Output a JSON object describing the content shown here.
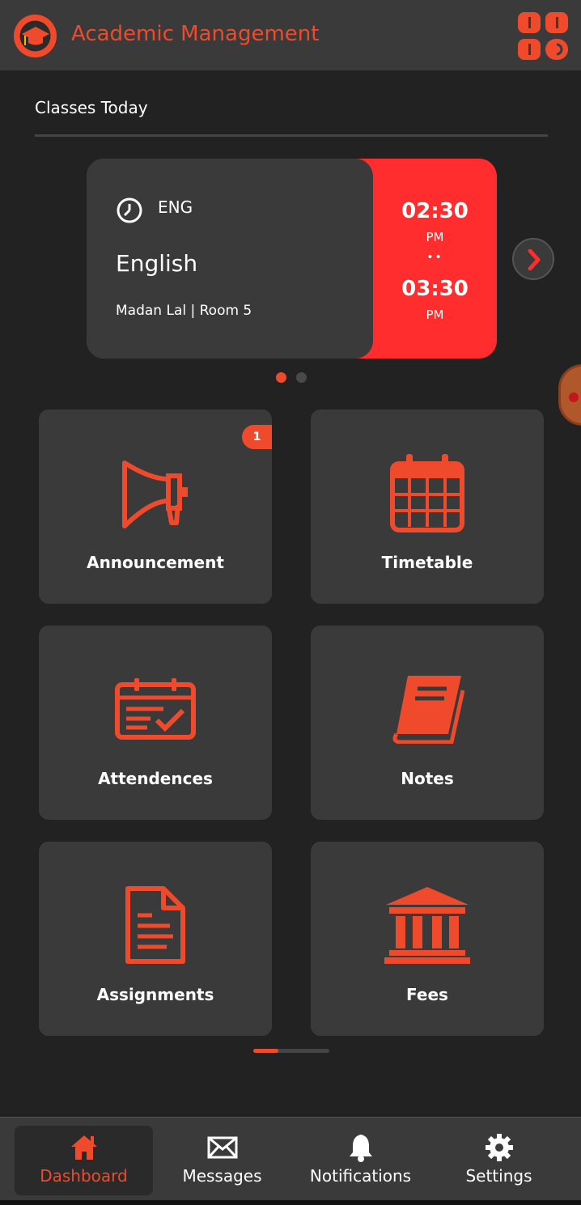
{
  "app": {
    "title": "Academic Management",
    "logo_icon": "graduation-cap-icon",
    "menu_icon": "grid-menu-icon"
  },
  "colors": {
    "accent": "#f04a2c",
    "card_time_bg": "#ff2d2d",
    "surface": "#3a3a3a",
    "background": "#222222"
  },
  "classes": {
    "section_title": "Classes Today",
    "current": {
      "code": "ENG",
      "name": "English",
      "meta": "Madan Lal | Room 5",
      "start_time": "02:30",
      "start_ampm": "PM",
      "separator": "••",
      "end_time": "03:30",
      "end_ampm": "PM"
    },
    "carousel_pages": 2,
    "carousel_active": 1
  },
  "tiles": [
    {
      "label": "Announcement",
      "icon": "megaphone-icon",
      "badge": "1"
    },
    {
      "label": "Timetable",
      "icon": "calendar-icon"
    },
    {
      "label": "Attendences",
      "icon": "attendance-calendar-icon"
    },
    {
      "label": "Notes",
      "icon": "book-icon"
    },
    {
      "label": "Assignments",
      "icon": "document-icon"
    },
    {
      "label": "Fees",
      "icon": "bank-icon"
    }
  ],
  "nav": [
    {
      "label": "Dashboard",
      "icon": "home-icon",
      "active": true
    },
    {
      "label": "Messages",
      "icon": "envelope-icon"
    },
    {
      "label": "Notifications",
      "icon": "bell-icon"
    },
    {
      "label": "Settings",
      "icon": "gear-icon"
    }
  ]
}
